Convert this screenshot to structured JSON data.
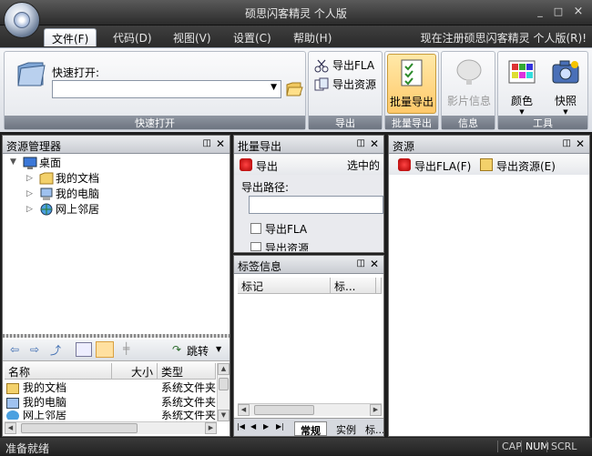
{
  "window": {
    "title": "硕思闪客精灵 个人版",
    "min": "_",
    "max": "□",
    "close": "×"
  },
  "menubar": {
    "items": [
      "文件(F)",
      "代码(D)",
      "视图(V)",
      "设置(C)",
      "帮助(H)"
    ],
    "active": 0,
    "registration": "现在注册硕思闪客精灵 个人版(R)!"
  },
  "ribbon": {
    "quickopen": {
      "label": "快速打开:",
      "value": "",
      "group": "快速打开"
    },
    "export": {
      "fla": "导出FLA",
      "res": "导出资源",
      "group": "导出"
    },
    "batch": {
      "label": "批量导出",
      "group": "批量导出"
    },
    "info": {
      "label": "影片信息",
      "group": "信息"
    },
    "tools": {
      "color": "颜色",
      "snap": "快照",
      "group": "工具"
    }
  },
  "explorer": {
    "title": "资源管理器",
    "root": "桌面",
    "items": [
      "我的文档",
      "我的电脑",
      "网上邻居"
    ],
    "toolbar": {
      "goto": "跳转"
    },
    "columns": [
      "名称",
      "大小",
      "类型"
    ],
    "files": [
      {
        "name": "我的文档",
        "size": "",
        "type": "系统文件夹"
      },
      {
        "name": "我的电脑",
        "size": "",
        "type": "系统文件夹"
      },
      {
        "name": "网上邻居",
        "size": "",
        "type": "系统文件夹"
      }
    ]
  },
  "batch": {
    "title": "批量导出",
    "export_btn": "导出",
    "selected": "选中的",
    "path_label": "导出路径:",
    "path_value": "",
    "opt_fla": "导出FLA",
    "opt_res": "导出资源"
  },
  "taginfo": {
    "title": "标签信息",
    "columns": [
      "标记",
      "标..."
    ],
    "tabs": [
      "常规",
      "实例",
      "标..."
    ]
  },
  "resources": {
    "title": "资源",
    "export_fla": "导出FLA(F)",
    "export_res": "导出资源(E)"
  },
  "status": {
    "text": "准备就绪",
    "caps": "CAP",
    "num": "NUM",
    "scrl": "SCRL"
  }
}
